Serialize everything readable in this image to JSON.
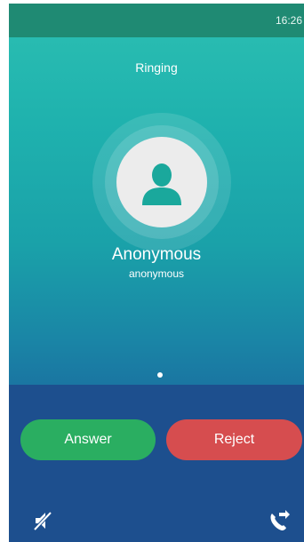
{
  "status_bar": {
    "time": "16:26"
  },
  "call": {
    "state": "Ringing",
    "contact_name": "Anonymous",
    "contact_number": "anonymous"
  },
  "actions": {
    "answer_label": "Answer",
    "reject_label": "Reject"
  },
  "icons": {
    "avatar": "person-icon",
    "mute": "mute-icon",
    "transfer": "call-transfer-icon"
  },
  "colors": {
    "status_bar": "#1f8a73",
    "answer": "#2aae61",
    "reject": "#d64d4f",
    "bottom_panel": "#1d4f8e",
    "avatar_icon": "#1aa89c"
  }
}
